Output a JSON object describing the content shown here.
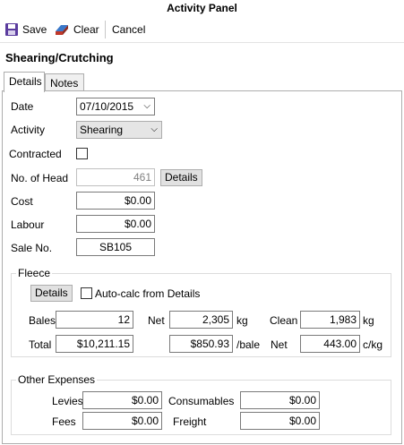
{
  "window": {
    "title": "Activity Panel"
  },
  "toolbar": {
    "save_label": "Save",
    "clear_label": "Clear",
    "cancel_label": "Cancel"
  },
  "heading": "Shearing/Crutching",
  "tabs": [
    {
      "label": "Details",
      "active": true
    },
    {
      "label": "Notes",
      "active": false
    }
  ],
  "details": {
    "date_label": "Date",
    "date_value": "07/10/2015",
    "activity_label": "Activity",
    "activity_value": "Shearing",
    "contracted_label": "Contracted",
    "contracted_checked": false,
    "head_label": "No. of Head",
    "head_value": "461",
    "head_details_button": "Details",
    "cost_label": "Cost",
    "cost_value": "$0.00",
    "labour_label": "Labour",
    "labour_value": "$0.00",
    "sale_label": "Sale No.",
    "sale_value": "SB105"
  },
  "fleece": {
    "title": "Fleece",
    "details_button": "Details",
    "autocalc_label": "Auto-calc from Details",
    "autocalc_checked": false,
    "bales_label": "Bales",
    "bales_value": "12",
    "net_label": "Net",
    "net_value": "2,305",
    "net_unit": "kg",
    "clean_label": "Clean",
    "clean_value": "1,983",
    "clean_unit": "kg",
    "total_label": "Total",
    "total_value": "$10,211.15",
    "per_bale_value": "$850.93",
    "per_bale_unit": "/bale",
    "net2_label": "Net",
    "net2_value": "443.00",
    "net2_unit": "c/kg"
  },
  "other": {
    "title": "Other Expenses",
    "levies_label": "Levies",
    "levies_value": "$0.00",
    "consumables_label": "Consumables",
    "consumables_value": "$0.00",
    "fees_label": "Fees",
    "fees_value": "$0.00",
    "freight_label": "Freight",
    "freight_value": "$0.00"
  }
}
